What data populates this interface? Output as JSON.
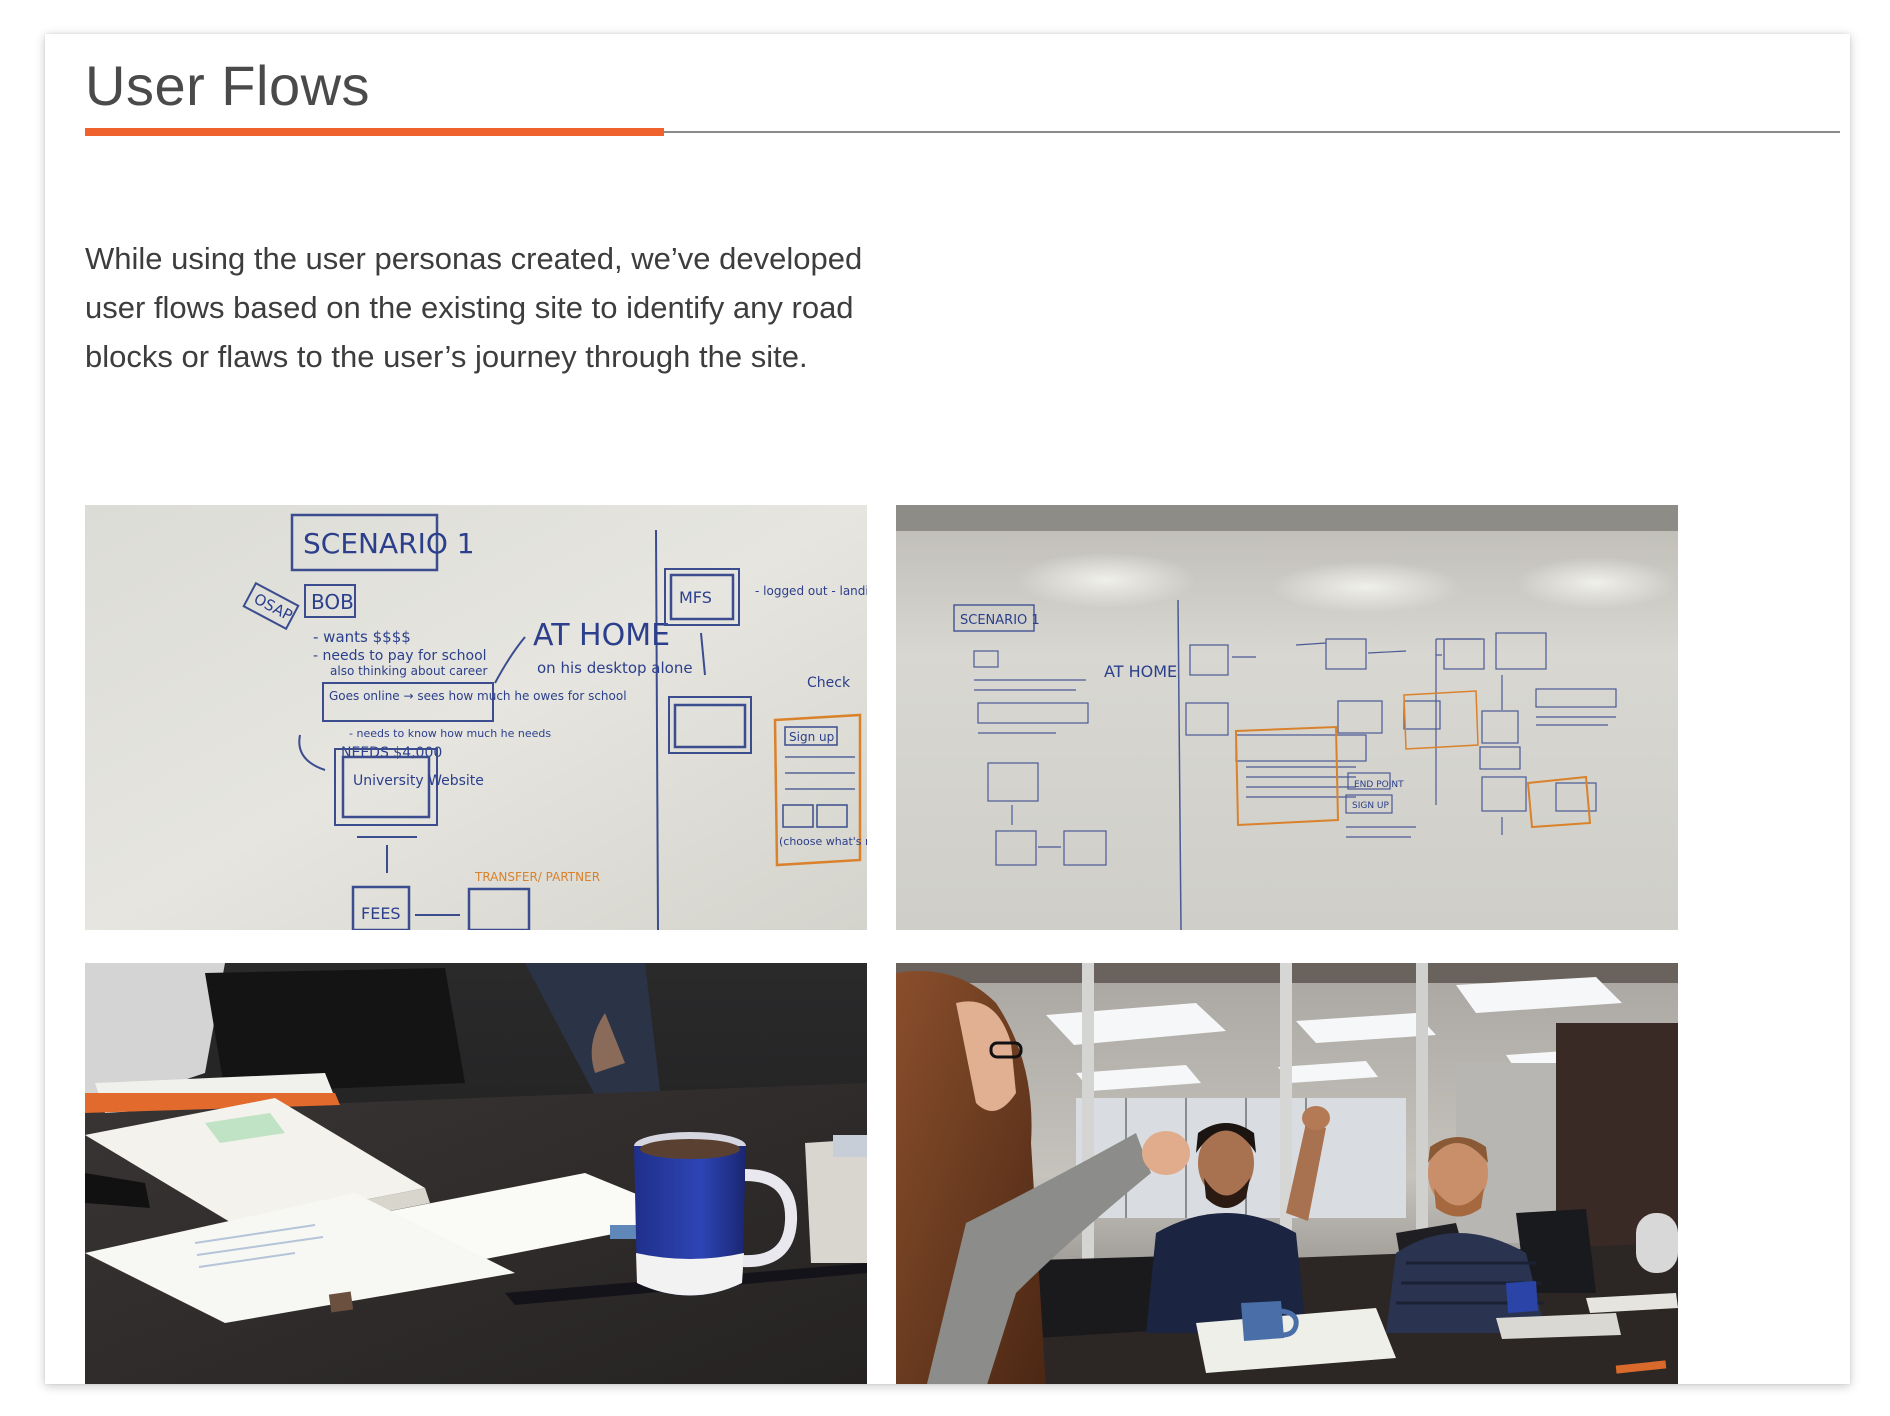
{
  "section": {
    "title": "User Flows",
    "accent_color": "#f0622d",
    "rule_color": "#8a8a8a",
    "intro": "While using the user personas created, we’ve developed user flows based on the existing site to identify any road blocks or flaws to the user’s journey through the site."
  },
  "gallery": {
    "photos": [
      {
        "name": "whiteboard-closeup-photo",
        "subject": "whiteboard user flow sketch, close-up"
      },
      {
        "name": "whiteboard-wide-photo",
        "subject": "whiteboard user flow sketch, wide view"
      },
      {
        "name": "table-mug-photo",
        "subject": "meeting table with papers, open book and blue mug"
      },
      {
        "name": "team-meeting-photo",
        "subject": "team discussing around conference table"
      }
    ],
    "whiteboard_text": {
      "scenario": "SCENARIO 1",
      "persona": "BOB",
      "osap": "OSAP",
      "wants": "- wants $$$$",
      "needs_pay": "- needs to pay for school",
      "also_thinking": "also thinking about career",
      "goes_online": "Goes online → sees how much he owes for school",
      "needs_know": "- needs to know how much he needs",
      "needs_amount": "NEEDS $4,000",
      "at_home": "AT HOME",
      "desktop": "on his desktop alone",
      "university": "University Website",
      "mfs": "MFS",
      "logged_out": "- logged out - landing",
      "sign_up": "Sign up",
      "fees": "FEES",
      "transfer": "TRANSFER/ PARTNER",
      "choose": "(choose what's m",
      "end_point": "END POINT",
      "sign_up_caps": "SIGN UP"
    }
  }
}
